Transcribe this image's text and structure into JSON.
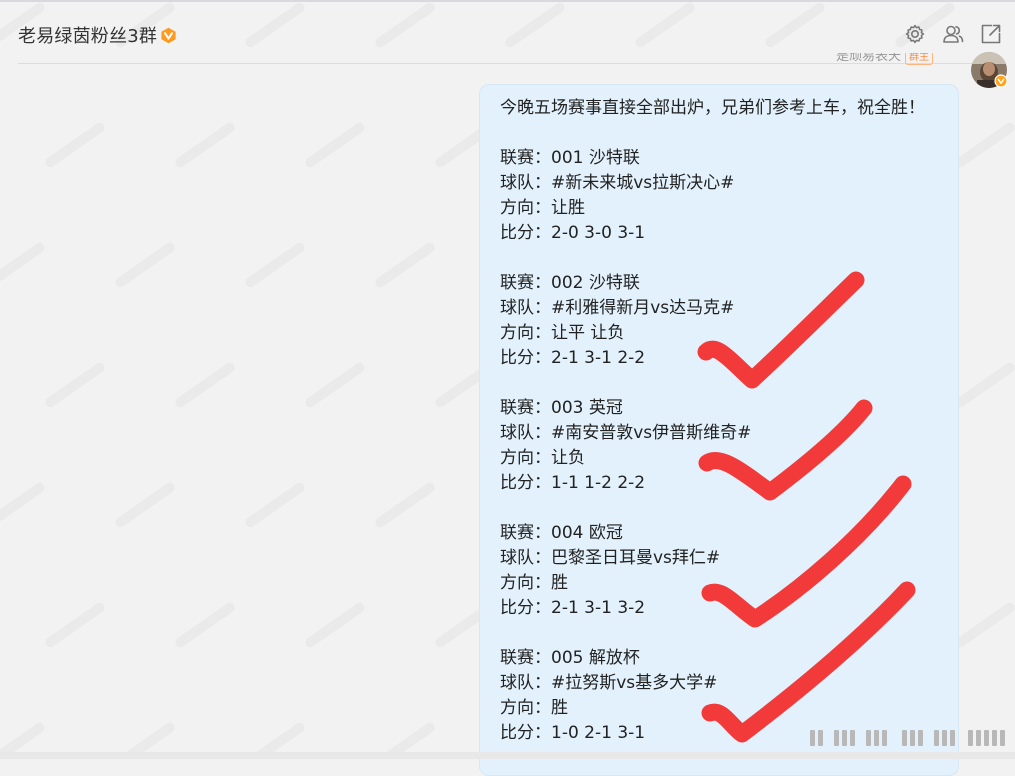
{
  "header": {
    "title": "老易绿茵粉丝3群",
    "icons": [
      "settings-icon",
      "members-icon",
      "popout-icon"
    ]
  },
  "sender": {
    "name": "是顽易表天",
    "role_tag": "群主"
  },
  "message": {
    "intro": "今晚五场赛事直接全部出炉，兄弟们参考上车，祝全胜！",
    "matches": [
      {
        "league": "联赛：001 沙特联",
        "teams": "球队：#新未来城vs拉斯决心#",
        "direction": "方向：让胜",
        "scores": "比分：2-0  3-0  3-1"
      },
      {
        "league": "联赛：002 沙特联",
        "teams": "球队：#利雅得新月vs达马克#",
        "direction": "方向：让平 让负",
        "scores": "比分：2-1  3-1  2-2"
      },
      {
        "league": "联赛：003 英冠",
        "teams": "球队：#南安普敦vs伊普斯维奇#",
        "direction": "方向：让负",
        "scores": "比分：1-1  1-2  2-2"
      },
      {
        "league": "联赛：004 欧冠",
        "teams": "球队：巴黎圣日耳曼vs拜仁#",
        "direction": "方向：胜",
        "scores": "比分：2-1  3-1  3-2"
      },
      {
        "league": "联赛：005 解放杯",
        "teams": "球队：#拉努斯vs基多大学#",
        "direction": "方向：胜",
        "scores": "比分：1-0  2-1  3-1"
      }
    ]
  },
  "annotations": {
    "check_color": "#f23a3a",
    "check_marks": [
      "red-check-mark",
      "red-check-mark",
      "red-check-mark",
      "red-check-mark"
    ]
  },
  "colors": {
    "background": "#f2f2f2",
    "bubble": "#e2f1fb",
    "title_text": "#333333",
    "vip_badge": "#ff9a1f"
  }
}
